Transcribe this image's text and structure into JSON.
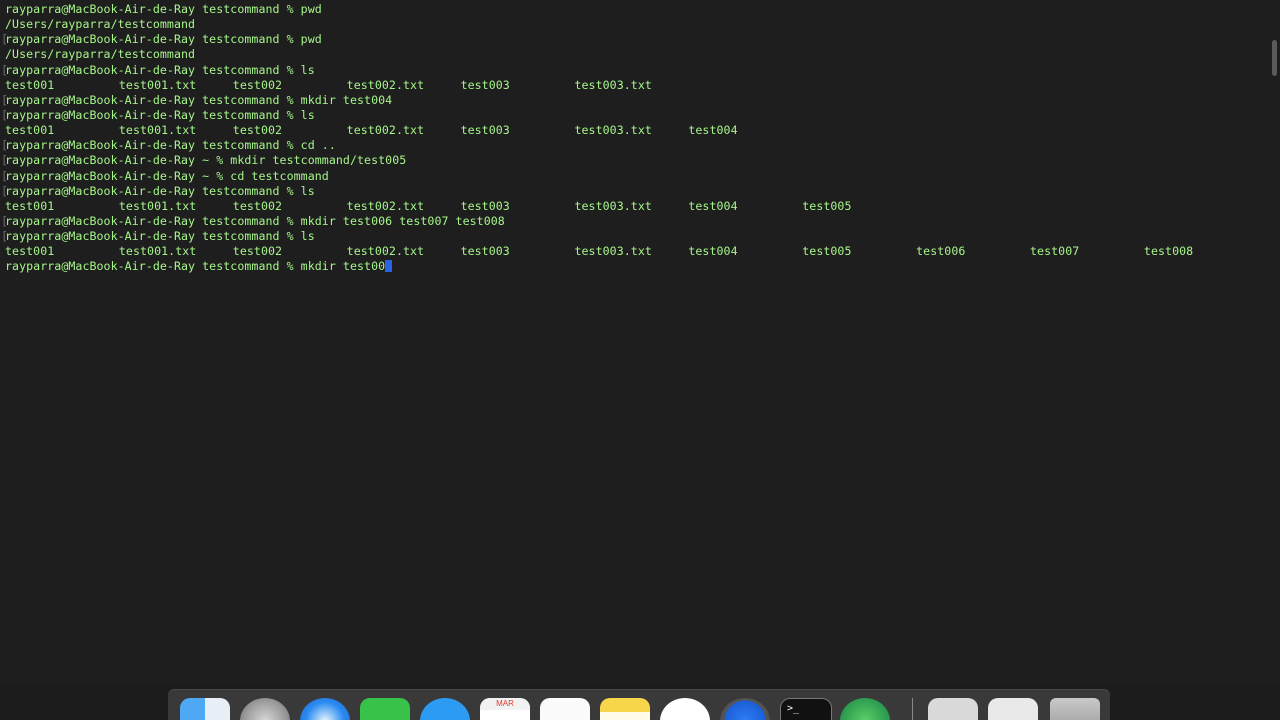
{
  "terminal": {
    "lines": [
      {
        "type": "text",
        "text": "rayparra@MacBook-Air-de-Ray testcommand % pwd",
        "bracket": false
      },
      {
        "type": "text",
        "text": "/Users/rayparra/testcommand",
        "bracket": false
      },
      {
        "type": "text",
        "text": "rayparra@MacBook-Air-de-Ray testcommand % pwd",
        "bracket": true
      },
      {
        "type": "text",
        "text": "/Users/rayparra/testcommand",
        "bracket": false
      },
      {
        "type": "text",
        "text": "rayparra@MacBook-Air-de-Ray testcommand % ls",
        "bracket": true
      },
      {
        "type": "cols",
        "cells": [
          "test001",
          "test001.txt",
          "test002",
          "test002.txt",
          "test003",
          "test003.txt"
        ],
        "bracket": false
      },
      {
        "type": "text",
        "text": "rayparra@MacBook-Air-de-Ray testcommand % mkdir test004",
        "bracket": true
      },
      {
        "type": "text",
        "text": "rayparra@MacBook-Air-de-Ray testcommand % ls",
        "bracket": true
      },
      {
        "type": "cols",
        "cells": [
          "test001",
          "test001.txt",
          "test002",
          "test002.txt",
          "test003",
          "test003.txt",
          "test004"
        ],
        "bracket": false
      },
      {
        "type": "text",
        "text": "rayparra@MacBook-Air-de-Ray testcommand % cd ..",
        "bracket": true
      },
      {
        "type": "text",
        "text": "rayparra@MacBook-Air-de-Ray ~ % mkdir testcommand/test005",
        "bracket": true
      },
      {
        "type": "text",
        "text": "rayparra@MacBook-Air-de-Ray ~ % cd testcommand",
        "bracket": true
      },
      {
        "type": "text",
        "text": "rayparra@MacBook-Air-de-Ray testcommand % ls",
        "bracket": true
      },
      {
        "type": "cols",
        "cells": [
          "test001",
          "test001.txt",
          "test002",
          "test002.txt",
          "test003",
          "test003.txt",
          "test004",
          "test005"
        ],
        "bracket": false
      },
      {
        "type": "text",
        "text": "rayparra@MacBook-Air-de-Ray testcommand % mkdir test006 test007 test008",
        "bracket": true
      },
      {
        "type": "text",
        "text": "rayparra@MacBook-Air-de-Ray testcommand % ls",
        "bracket": true
      },
      {
        "type": "cols",
        "cells": [
          "test001",
          "test001.txt",
          "test002",
          "test002.txt",
          "test003",
          "test003.txt",
          "test004",
          "test005",
          "test006",
          "test007",
          "test008"
        ],
        "bracket": false
      },
      {
        "type": "text",
        "text": "rayparra@MacBook-Air-de-Ray testcommand % mkdir test00",
        "bracket": false,
        "cursor": true
      }
    ],
    "colors": {
      "background": "#1e1e1e",
      "text": "#a6f58a",
      "cursor": "#2a62e6"
    }
  },
  "dock": {
    "items": [
      {
        "name": "finder-icon",
        "class": "finder"
      },
      {
        "name": "launchpad-icon",
        "class": "launchpad"
      },
      {
        "name": "safari-icon",
        "class": "safari"
      },
      {
        "name": "facetime-icon",
        "class": "facetime"
      },
      {
        "name": "messages-icon",
        "class": "messages"
      },
      {
        "name": "calendar-icon",
        "class": "calendar",
        "label": "MAR"
      },
      {
        "name": "reminders-icon",
        "class": "reminders"
      },
      {
        "name": "notes-icon",
        "class": "notes"
      },
      {
        "name": "itunes-icon",
        "class": "itunes"
      },
      {
        "name": "app-store-icon",
        "class": "appstore"
      },
      {
        "name": "terminal-icon",
        "class": "terminal-app",
        "label": ">_"
      },
      {
        "name": "atom-icon",
        "class": "atom"
      },
      {
        "name": "documents-stack-icon",
        "class": "docs1"
      },
      {
        "name": "downloads-stack-icon",
        "class": "docs2"
      },
      {
        "name": "trash-icon",
        "class": "trash"
      }
    ]
  }
}
